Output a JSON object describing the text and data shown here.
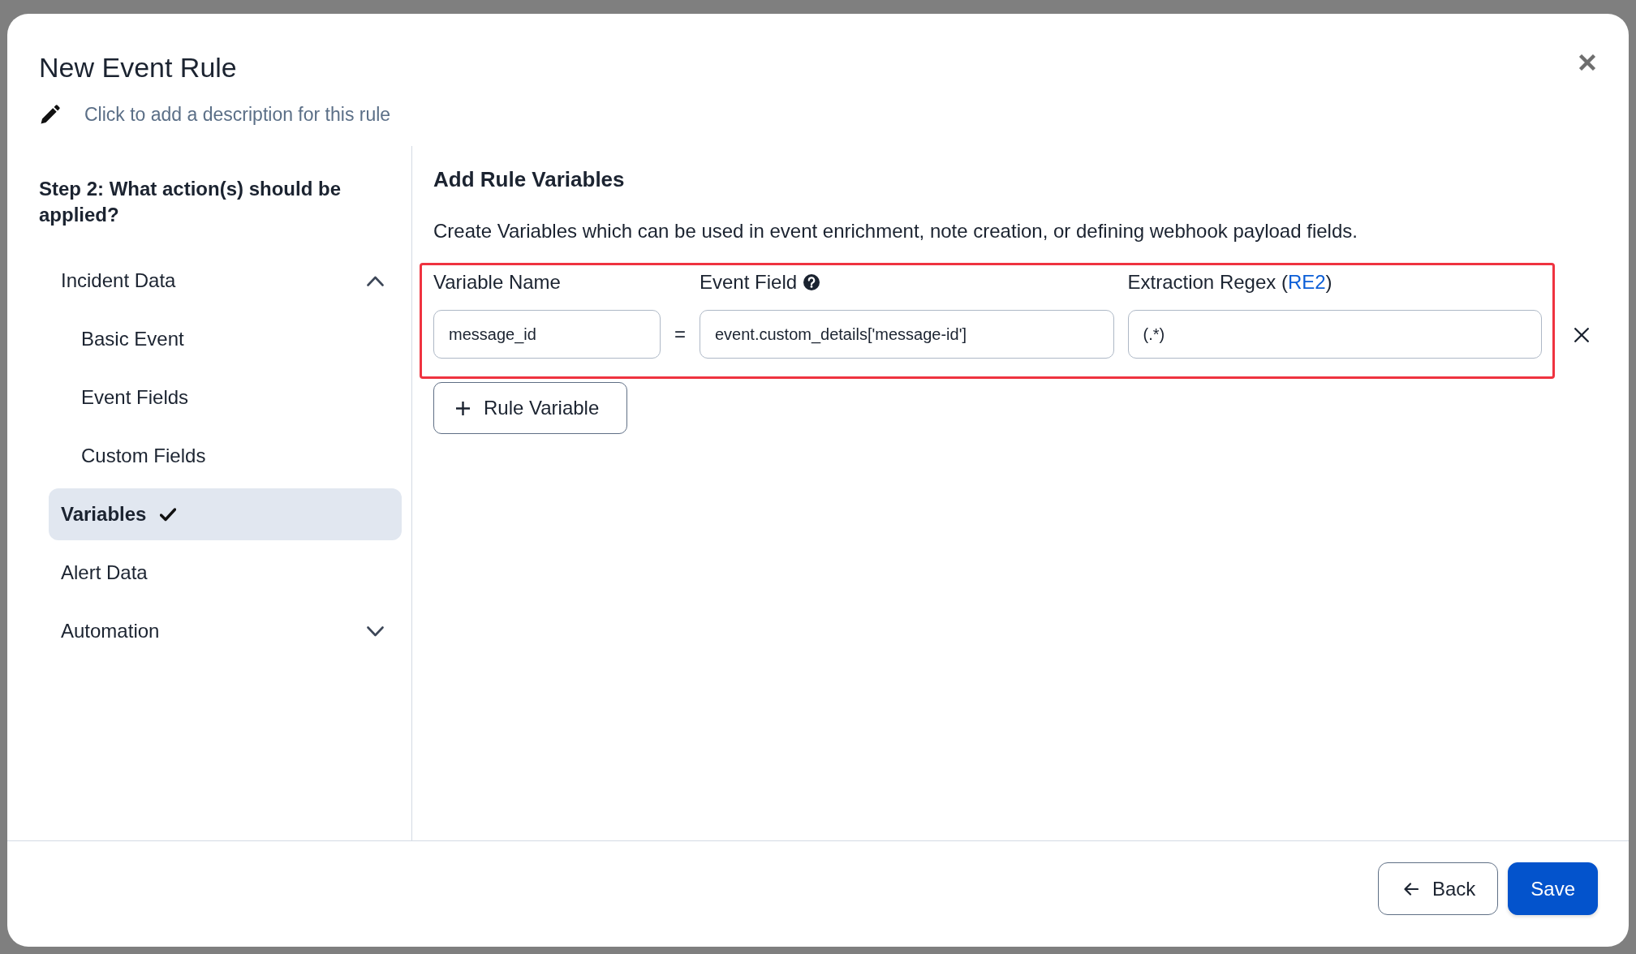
{
  "dialog": {
    "title": "New Event Rule",
    "description_prompt": "Click to add a description for this rule"
  },
  "sidebar": {
    "heading": "Step 2: What action(s) should be applied?",
    "items": [
      {
        "label": "Incident Data",
        "selected": false,
        "completed": false,
        "expanded": true,
        "children": [
          {
            "label": "Basic Event",
            "selected": false,
            "completed": false
          },
          {
            "label": "Event Fields",
            "selected": false,
            "completed": false
          },
          {
            "label": "Custom Fields",
            "selected": false,
            "completed": false
          },
          {
            "label": "Variables",
            "selected": true,
            "completed": true
          }
        ]
      },
      {
        "label": "Alert Data",
        "selected": false,
        "completed": false
      },
      {
        "label": "Automation",
        "selected": false,
        "completed": false,
        "expanded": false
      }
    ]
  },
  "panel": {
    "title": "Add Rule Variables",
    "intro": "Create Variables which can be used in event enrichment, note creation, or defining webhook payload fields.",
    "columns": [
      {
        "label": "Variable Name",
        "help": false
      },
      {
        "label": "Event Field",
        "help": true
      },
      {
        "label": "Extraction Regex (",
        "link": "RE2",
        "label_end": ")",
        "help": false
      }
    ],
    "rows": [
      {
        "cells": [
          "message_id",
          "event.custom_details['message-id']",
          "(.*)"
        ],
        "separator": "=",
        "highlighted": true
      }
    ],
    "add_button": "Rule Variable"
  },
  "footer": {
    "buttons": [
      {
        "label": "Back",
        "kind": "back"
      },
      {
        "label": "Save",
        "kind": "primary"
      }
    ]
  }
}
